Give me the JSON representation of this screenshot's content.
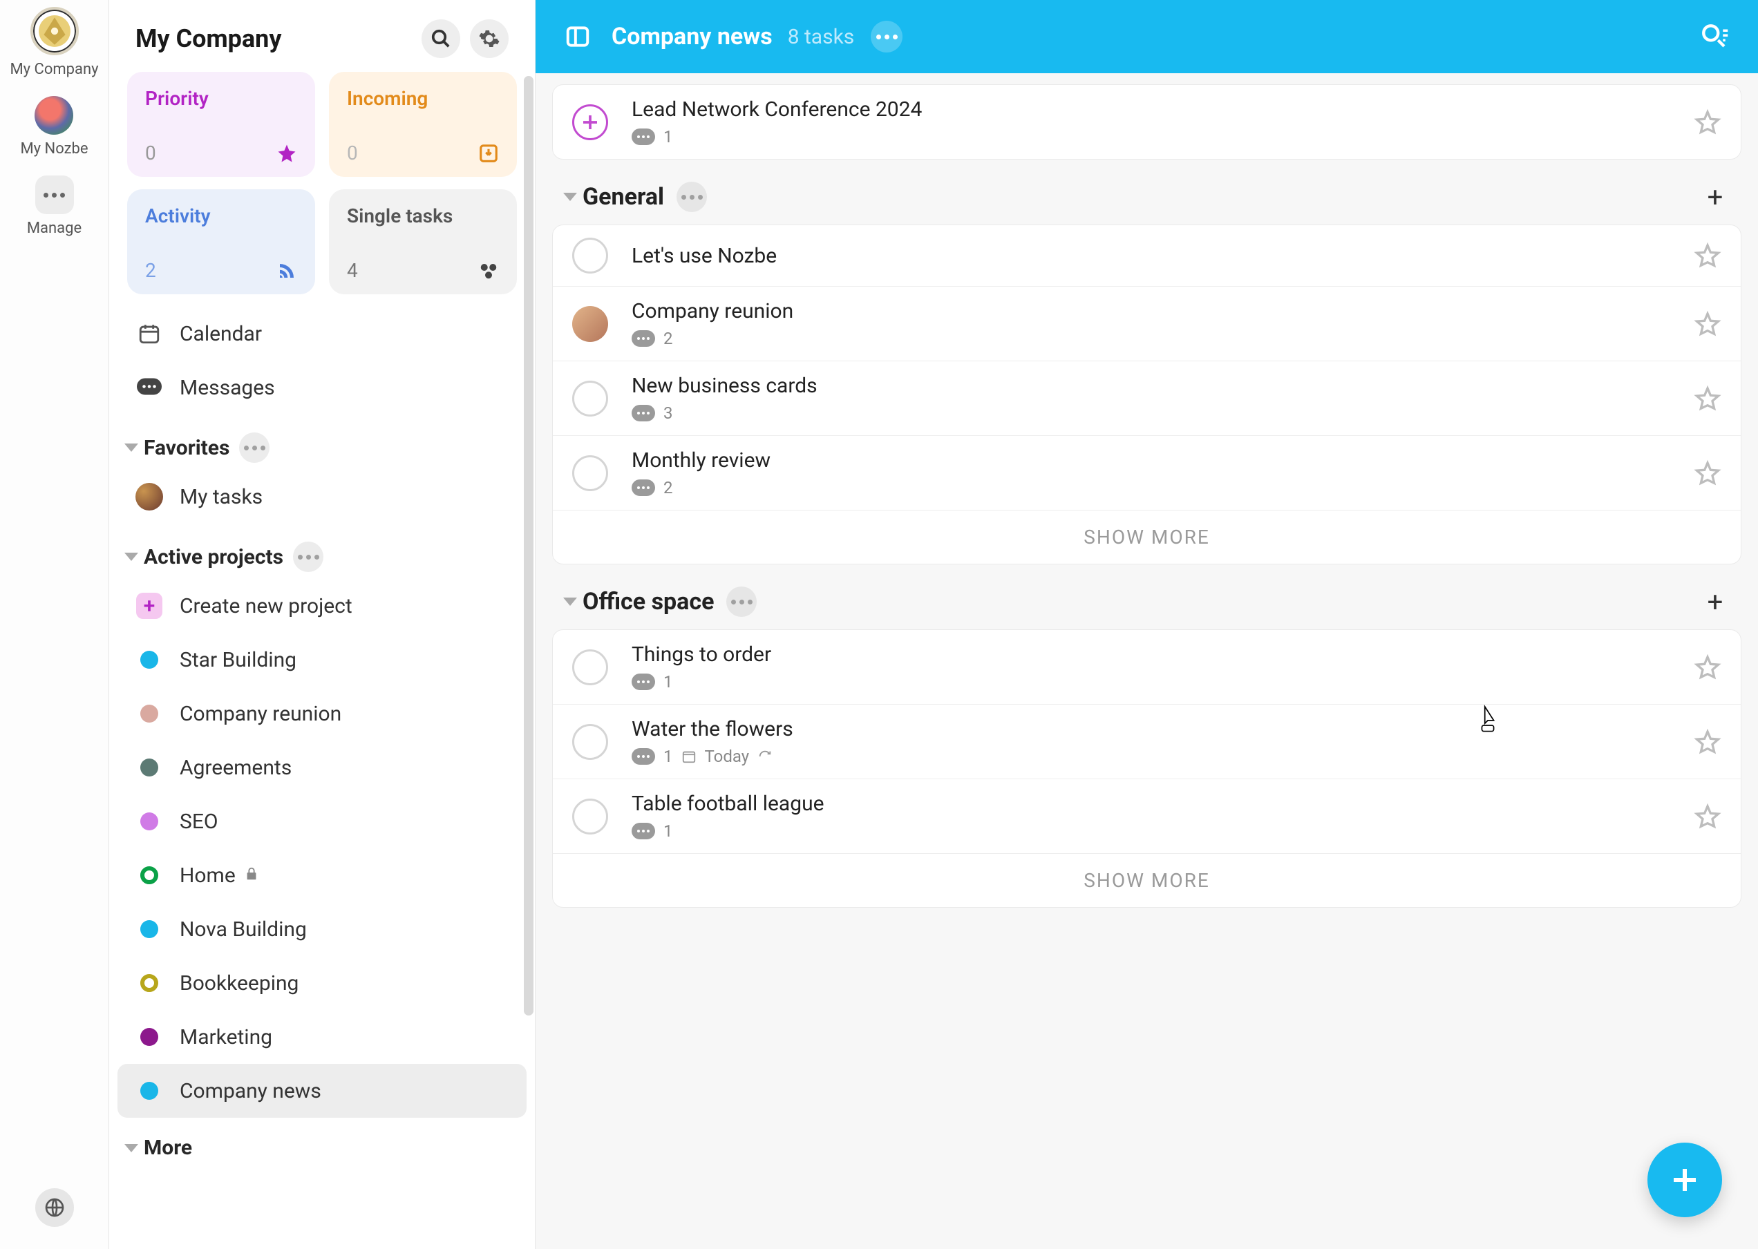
{
  "rail": {
    "company": "My Company",
    "nozbe": "My Nozbe",
    "manage": "Manage"
  },
  "sidebar": {
    "title": "My Company",
    "cards": {
      "priority": {
        "label": "Priority",
        "count": "0"
      },
      "incoming": {
        "label": "Incoming",
        "count": "0"
      },
      "activity": {
        "label": "Activity",
        "count": "2"
      },
      "single": {
        "label": "Single tasks",
        "count": "4"
      }
    },
    "rows": {
      "calendar": "Calendar",
      "messages": "Messages"
    },
    "favorites": {
      "title": "Favorites",
      "items": [
        "My tasks"
      ]
    },
    "active": {
      "title": "Active projects",
      "create": "Create new project",
      "projects": [
        {
          "label": "Star Building",
          "color": "#19b6e8",
          "ring": false
        },
        {
          "label": "Company reunion",
          "color": "#d9a9a0",
          "ring": false
        },
        {
          "label": "Agreements",
          "color": "#5c7a74",
          "ring": false
        },
        {
          "label": "SEO",
          "color": "#d07be6",
          "ring": false
        },
        {
          "label": "Home",
          "color": "#0aa147",
          "ring": true,
          "locked": true
        },
        {
          "label": "Nova Building",
          "color": "#19b6e8",
          "ring": false
        },
        {
          "label": "Bookkeeping",
          "color": "#b7a61b",
          "ring": true
        },
        {
          "label": "Marketing",
          "color": "#8c188c",
          "ring": false
        },
        {
          "label": "Company news",
          "color": "#19b6e8",
          "ring": false,
          "active": true
        }
      ]
    },
    "more": "More"
  },
  "main": {
    "title": "Company news",
    "subtitle": "8 tasks",
    "top_task": {
      "title": "Lead Network Conference 2024",
      "comments": "1"
    },
    "sections": [
      {
        "title": "General",
        "tasks": [
          {
            "title": "Let's use Nozbe"
          },
          {
            "title": "Company reunion",
            "comments": "2",
            "avatar": true
          },
          {
            "title": "New business cards",
            "comments": "3"
          },
          {
            "title": "Monthly review",
            "comments": "2"
          }
        ],
        "show_more": "SHOW MORE"
      },
      {
        "title": "Office space",
        "tasks": [
          {
            "title": "Things to order",
            "comments": "1"
          },
          {
            "title": "Water the flowers",
            "comments": "1",
            "date": "Today",
            "repeat": true
          },
          {
            "title": "Table football league",
            "comments": "1"
          }
        ],
        "show_more": "SHOW MORE"
      }
    ]
  }
}
